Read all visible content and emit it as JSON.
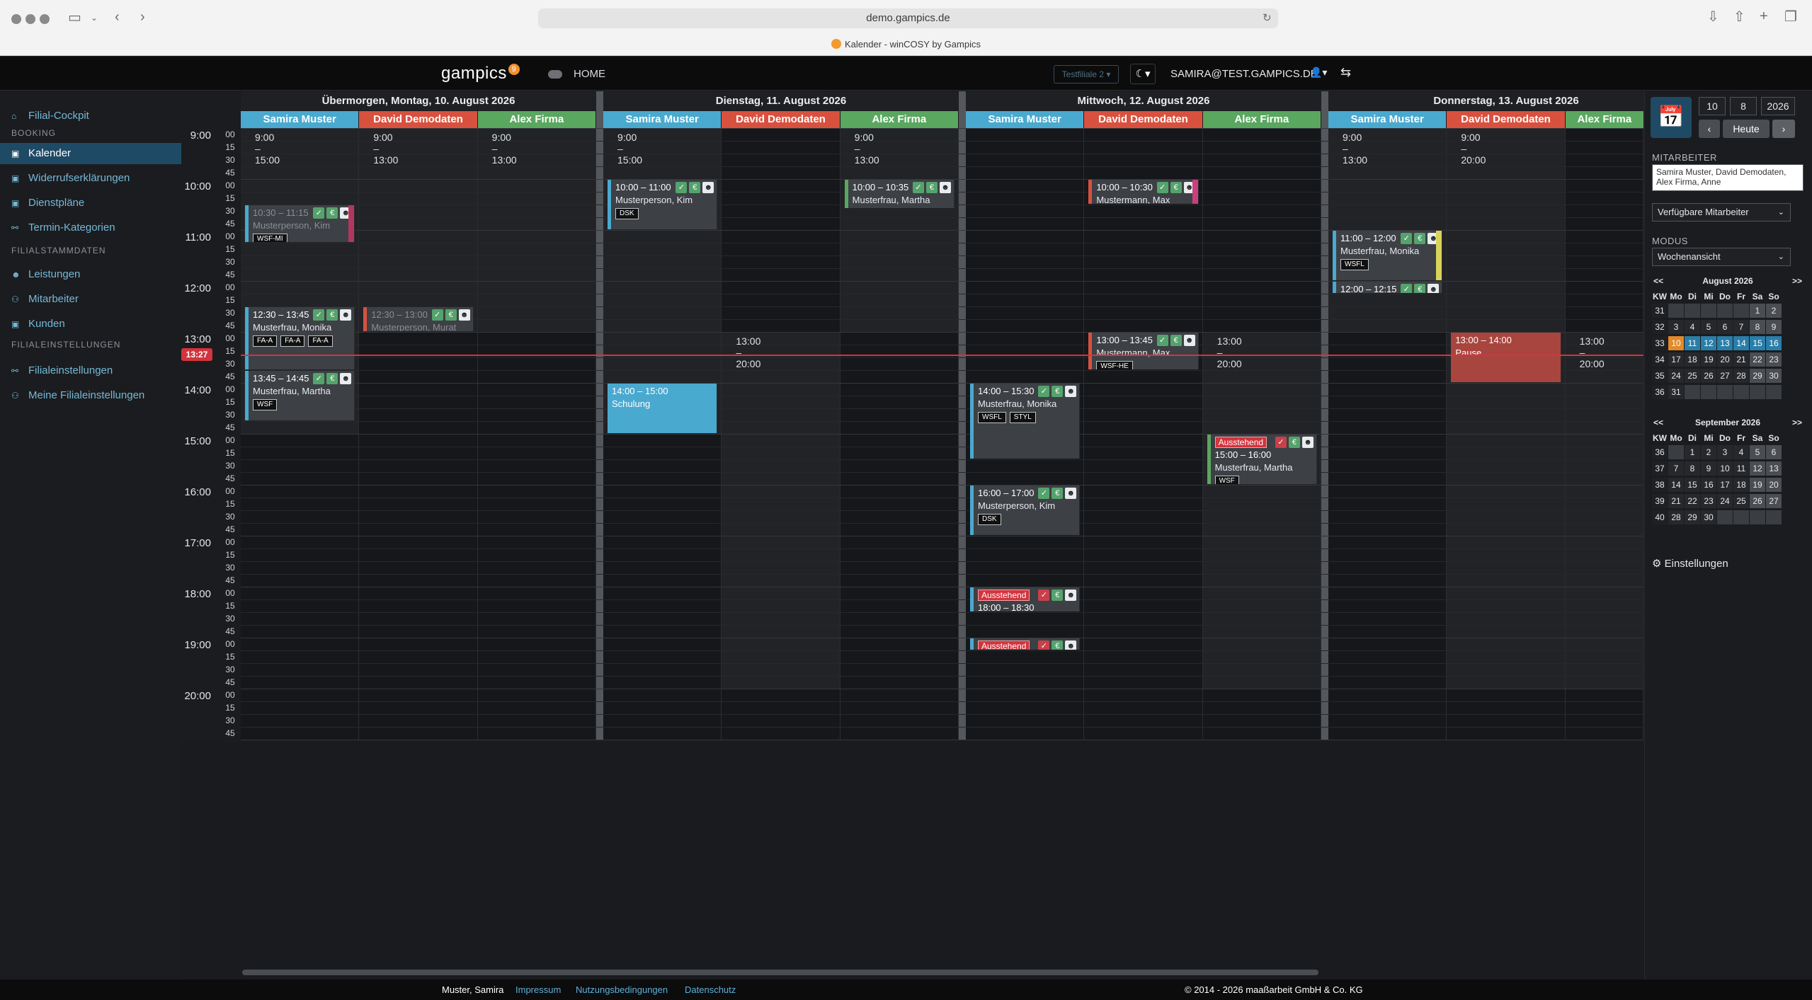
{
  "browser": {
    "url": "demo.gampics.de",
    "tab_title": "Kalender - winCOSY by Gampics"
  },
  "appbar": {
    "logo": "gampics",
    "logo_badge": "9",
    "home": "HOME",
    "filiale": "Testfiliale 2 ▾",
    "user": "SAMIRA@TEST.GAMPICS.DE"
  },
  "sidebar": {
    "items": [
      {
        "label": "Filial-Cockpit",
        "icon": "home-icon"
      },
      {
        "label": "Kalender",
        "icon": "calendar-icon"
      },
      {
        "label": "Widerrufserklärungen",
        "icon": "calendar-icon"
      },
      {
        "label": "Dienstpläne",
        "icon": "calendar-icon"
      },
      {
        "label": "Termin-Kategorien",
        "icon": "link-icon"
      },
      {
        "label": "Leistungen",
        "icon": "user-icon"
      },
      {
        "label": "Mitarbeiter",
        "icon": "users-icon"
      },
      {
        "label": "Kunden",
        "icon": "calendar-icon"
      },
      {
        "label": "Filialeinstellungen",
        "icon": "link-icon"
      },
      {
        "label": "Meine Filialeinstellungen",
        "icon": "users-icon"
      }
    ],
    "headers": [
      "BOOKING",
      "FILIALSTAMMDATEN",
      "FILIALEINSTELLUNGEN"
    ]
  },
  "calendar": {
    "clock": "13:27",
    "now_label": "13:27",
    "hours": [
      "9:00",
      "10:00",
      "11:00",
      "12:00",
      "13:00",
      "14:00",
      "15:00",
      "16:00",
      "17:00",
      "18:00",
      "19:00",
      "20:00"
    ],
    "quarters": [
      "00",
      "15",
      "30",
      "45"
    ],
    "days": [
      {
        "title": "Übermorgen, Montag, 10. August 2026",
        "employees": [
          "Samira Muster",
          "David Demodaten",
          "Alex Firma"
        ],
        "shifts": [
          "9:00 – 15:00",
          "9:00 – 13:00",
          "9:00 – 13:00"
        ]
      },
      {
        "title": "Dienstag, 11. August 2026",
        "employees": [
          "Samira Muster",
          "David Demodaten",
          "Alex Firma"
        ],
        "shifts": [
          "9:00 – 15:00",
          "13:00 – 20:00",
          "9:00 – 13:00"
        ]
      },
      {
        "title": "Mittwoch, 12. August 2026",
        "employees": [
          "Samira Muster",
          "David Demodaten",
          "Alex Firma"
        ],
        "shifts": [
          "",
          "",
          "13:00 – 20:00"
        ]
      },
      {
        "title": "Donnerstag, 13. August 2026",
        "employees": [
          "Samira Muster",
          "David Demodaten",
          "Alex Firma"
        ],
        "shifts": [
          "9:00 – 13:00",
          "9:00 – 20:00",
          "13:00 – 20:00"
        ]
      }
    ],
    "employee_colors": [
      "#4aa9cf",
      "#d8513f",
      "#5aa760"
    ],
    "events": [
      {
        "label": "10:30 – 11:15",
        "name": "Musterperson, Kim",
        "tags": [
          "WSF-MI"
        ],
        "dim": true
      },
      {
        "label": "12:30 – 13:45",
        "name": "Musterfrau, Monika",
        "tags": [
          "FA-A",
          "FA-A",
          "FA-A"
        ]
      },
      {
        "label": "13:45 – 14:45",
        "name": "Musterfrau, Martha",
        "tags": [
          "WSF"
        ]
      },
      {
        "label": "12:30 – 13:00",
        "name": "Musterperson, Murat",
        "tags": [],
        "dim": true
      },
      {
        "label": "10:00 – 11:00",
        "name": "Musterperson, Kim",
        "tags": [
          "DSK"
        ]
      },
      {
        "label": "14:00 – 15:00",
        "name": "Schulung",
        "tags": []
      },
      {
        "label": "10:00 – 10:35",
        "name": "Musterfrau, Martha",
        "tags": []
      },
      {
        "label": "14:00 – 15:30",
        "name": "Musterfrau, Monika",
        "tags": [
          "WSFL",
          "STYL"
        ]
      },
      {
        "label": "16:00 – 17:00",
        "name": "Musterperson, Kim",
        "tags": [
          "DSK"
        ]
      },
      {
        "label": "18:00 – 18:30",
        "name": "",
        "tags": [],
        "status": "Ausstehend"
      },
      {
        "label": "",
        "name": "",
        "tags": [],
        "status": "Ausstehend"
      },
      {
        "label": "10:00 – 10:30",
        "name": "Mustermann, Max",
        "tags": []
      },
      {
        "label": "13:00 – 13:45",
        "name": "Mustermann, Max",
        "tags": [
          "WSF-HE"
        ]
      },
      {
        "label": "15:00 – 16:00",
        "name": "Musterfrau, Martha",
        "tags": [
          "WSF"
        ],
        "status": "Ausstehend"
      },
      {
        "label": "11:00 – 12:00",
        "name": "Musterfrau, Monika",
        "tags": [
          "WSFL"
        ]
      },
      {
        "label": "12:00 – 12:15",
        "name": "",
        "tags": []
      },
      {
        "label": "13:00 – 14:00",
        "name": "Pause",
        "tags": []
      }
    ]
  },
  "rightpanel": {
    "day": "10",
    "month": "8",
    "year": "2026",
    "today": "Heute",
    "mitarbeiter_label": "MITARBEITER",
    "mitarbeiter_value": "Samira Muster, David Demodaten, Alex Firma, Anne",
    "verfuegbar": "Verfügbare Mitarbeiter",
    "modus_label": "MODUS",
    "modus_value": "Wochenansicht",
    "settings": "Einstellungen",
    "dow": [
      "KW",
      "Mo",
      "Di",
      "Mi",
      "Do",
      "Fr",
      "Sa",
      "So"
    ],
    "august": {
      "title": "August 2026",
      "weeks": [
        [
          "31",
          "",
          "",
          "",
          "",
          "",
          "1",
          "2"
        ],
        [
          "32",
          "3",
          "4",
          "5",
          "6",
          "7",
          "8",
          "9"
        ],
        [
          "33",
          "10",
          "11",
          "12",
          "13",
          "14",
          "15",
          "16"
        ],
        [
          "34",
          "17",
          "18",
          "19",
          "20",
          "21",
          "22",
          "23"
        ],
        [
          "35",
          "24",
          "25",
          "26",
          "27",
          "28",
          "29",
          "30"
        ],
        [
          "36",
          "31",
          "",
          "",
          "",
          "",
          "",
          ""
        ]
      ]
    },
    "september": {
      "title": "September 2026",
      "weeks": [
        [
          "36",
          "",
          "1",
          "2",
          "3",
          "4",
          "5",
          "6"
        ],
        [
          "37",
          "7",
          "8",
          "9",
          "10",
          "11",
          "12",
          "13"
        ],
        [
          "38",
          "14",
          "15",
          "16",
          "17",
          "18",
          "19",
          "20"
        ],
        [
          "39",
          "21",
          "22",
          "23",
          "24",
          "25",
          "26",
          "27"
        ],
        [
          "40",
          "28",
          "29",
          "30",
          "",
          "",
          "",
          ""
        ]
      ]
    }
  },
  "footer": {
    "user": "Muster, Samira",
    "links": [
      "Impressum",
      "Nutzungsbedingungen",
      "Datenschutz"
    ],
    "copyright": "© 2014 - 2026 maaßarbeit GmbH & Co. KG"
  }
}
